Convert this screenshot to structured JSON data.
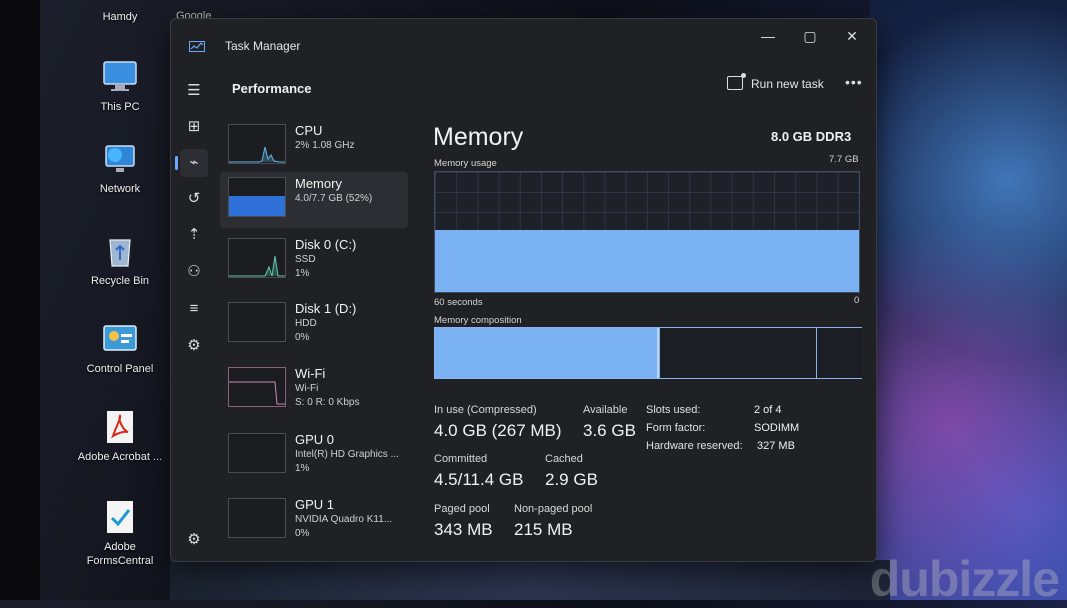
{
  "desktop": {
    "icons": [
      {
        "label": "Hamdy"
      },
      {
        "label": "This PC"
      },
      {
        "label": "Network"
      },
      {
        "label": "Recycle Bin"
      },
      {
        "label": "Control Panel"
      },
      {
        "label": "Adobe Acrobat ..."
      },
      {
        "label": "Adobe FormsCentral"
      }
    ],
    "partial_label": "Google",
    "watermark": "dubizzle"
  },
  "window": {
    "title": "Task Manager",
    "minimize": "—",
    "maximize": "▢",
    "close": "✕"
  },
  "header": {
    "page_title": "Performance",
    "run_new_task": "Run new task",
    "more": "•••"
  },
  "nav": [
    {
      "icon": "hamburger-menu-icon",
      "glyph": "☰"
    },
    {
      "icon": "processes-icon",
      "glyph": "⊞"
    },
    {
      "icon": "performance-icon",
      "glyph": "⌁"
    },
    {
      "icon": "app-history-icon",
      "glyph": "↺"
    },
    {
      "icon": "startup-apps-icon",
      "glyph": "⇡"
    },
    {
      "icon": "users-icon",
      "glyph": "⚇"
    },
    {
      "icon": "details-icon",
      "glyph": "≡"
    },
    {
      "icon": "services-icon",
      "glyph": "⚙"
    },
    {
      "icon": "settings-icon",
      "glyph": "⚙"
    }
  ],
  "resources": [
    {
      "name": "CPU",
      "sub": "2%  1.08 GHz",
      "sub2": ""
    },
    {
      "name": "Memory",
      "sub": "4.0/7.7 GB (52%)",
      "sub2": ""
    },
    {
      "name": "Disk 0 (C:)",
      "sub": "SSD",
      "sub2": "1%"
    },
    {
      "name": "Disk 1 (D:)",
      "sub": "HDD",
      "sub2": "0%"
    },
    {
      "name": "Wi-Fi",
      "sub": "Wi-Fi",
      "sub2": "S: 0  R: 0 Kbps"
    },
    {
      "name": "GPU 0",
      "sub": "Intel(R) HD Graphics ...",
      "sub2": "1%"
    },
    {
      "name": "GPU 1",
      "sub": "NVIDIA Quadro K11...",
      "sub2": "0%"
    }
  ],
  "memory": {
    "title": "Memory",
    "type": "8.0 GB DDR3",
    "usage_label": "Memory usage",
    "max_label": "7.7 GB",
    "time_label": "60 seconds",
    "zero_label": "0",
    "usage_fraction": 0.52,
    "composition_label": "Memory composition",
    "composition": {
      "in_use_fraction": 0.52,
      "modified_fraction": 0.005,
      "standby_fraction": 0.37,
      "free_fraction": 0.105
    },
    "in_use_label": "In use (Compressed)",
    "in_use_value": "4.0 GB (267 MB)",
    "available_label": "Available",
    "available_value": "3.6 GB",
    "committed_label": "Committed",
    "committed_value": "4.5/11.4 GB",
    "cached_label": "Cached",
    "cached_value": "2.9 GB",
    "paged_label": "Paged pool",
    "paged_value": "343 MB",
    "nonpaged_label": "Non-paged pool",
    "nonpaged_value": "215 MB",
    "slots_label": "Slots used:",
    "slots_value": "2 of 4",
    "form_label": "Form factor:",
    "form_value": "SODIMM",
    "hw_label": "Hardware reserved:",
    "hw_value": "327 MB"
  },
  "colors": {
    "accent": "#6ca8ff",
    "memory_fill": "#7bb2f3",
    "cpu_line": "#5fb8e8",
    "wifi_line": "#c98ab8"
  }
}
